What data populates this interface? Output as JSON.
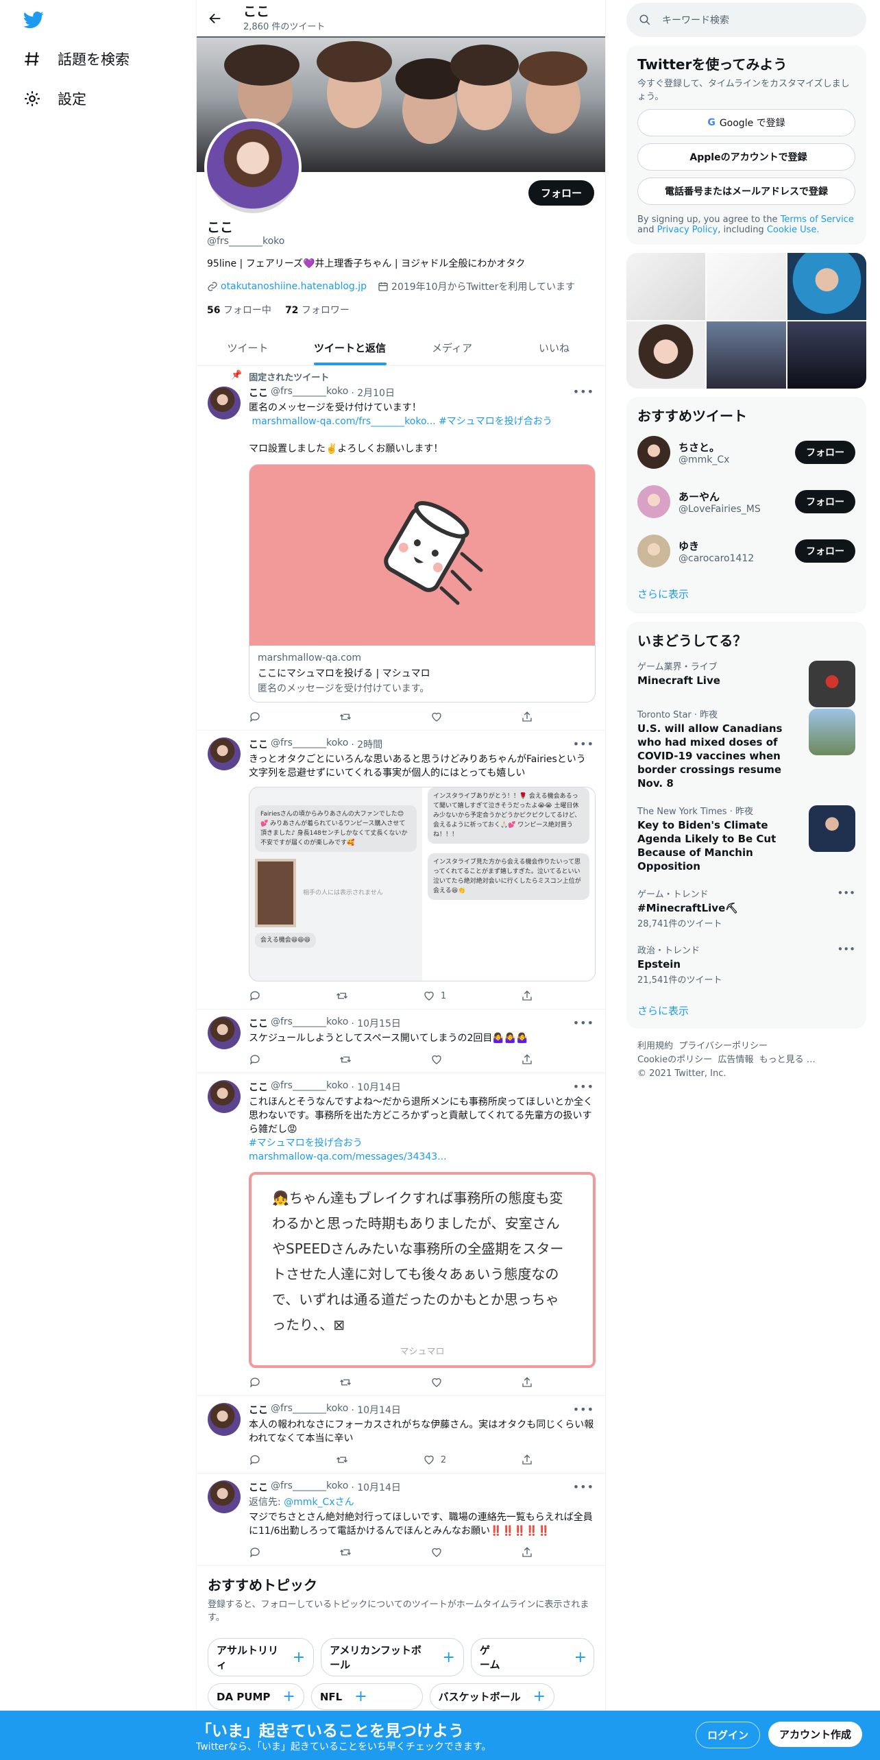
{
  "nav": {
    "explore": "話題を検索",
    "settings": "設定"
  },
  "header": {
    "title": "ここ",
    "tweet_count": "2,860 件のツイート"
  },
  "profile": {
    "follow": "フォロー",
    "name": "ここ",
    "handle": "@frs_______koko",
    "bio": "95line | フェアリーズ💜井上理香子ちゃん | ヨジャドル全般にわかオタク",
    "link": "otakutanoshiine.hatenablog.jp",
    "joined": "2019年10月からTwitterを利用しています",
    "following_count": "56",
    "following_label": "フォロー中",
    "followers_count": "72",
    "followers_label": "フォロワー"
  },
  "tabs": [
    "ツイート",
    "ツイートと返信",
    "メディア",
    "いいね"
  ],
  "tweets": [
    {
      "pinned": "固定されたツイート",
      "name": "ここ",
      "handle": "@frs_______koko",
      "time": "· 2月10日",
      "l1": "匿名のメッセージを受け付けています！",
      "l2a": "marshmallow-qa.com/frs_______koko...",
      "l2b": "#マシュマロを投げ合おう",
      "l3": "マロ設置しました✌️よろしくお願いします！",
      "card_domain": "marshmallow-qa.com",
      "card_title": "ここにマシュマロを投げる | マシュマロ",
      "card_desc": "匿名のメッセージを受け付けています。"
    },
    {
      "name": "ここ",
      "handle": "@frs_______koko",
      "time": "· 2時間",
      "text": "きっとオタクごとにいろんな思いあると思うけどみりあちゃんがFairiesという文字列を忌避せずにいてくれる事実が個人的にはとっても嬉しい",
      "likes": "1",
      "s1": "Fairiesさんの頃からみりあさんの大ファンでした😊💕 みりあさんが着られているワンピース購入させて頂きました♪ 身長148センチしかなくて丈長くないか不安ですが届くのが楽しみです🥰",
      "s2": "インスタライブありがとう！！🌹 会える機会あるって聞いて嬉しすぎて泣きそうだったよ😭😭 土曜日休み少ないから予定合うかどうかピクピクしてるけど、会えるように祈っておく🙏🏻💕 ワンピース絶対買うね！！！",
      "s3": "インスタライブ見た方から会える機会作りたいって思ってくれてることがまず嬉しすぎた。泣いてるといい泣いてたら絶対絶対会いに行くしたらミスコン上位が会える😆👏",
      "s4": "会える機会😆😆😆",
      "s5": "相手の人には表示されません"
    },
    {
      "name": "ここ",
      "handle": "@frs_______koko",
      "time": "· 10月15日",
      "text": "スケジュールしようとしてスペース開いてしまうの2回目🤷‍♀️🤷‍♀️🤷‍♀️"
    },
    {
      "name": "ここ",
      "handle": "@frs_______koko",
      "time": "· 10月14日",
      "text": "これほんとそうなんですよね〜だから退所メンにも事務所戻ってほしいとか全く思わないです。事務所を出た方どころかずっと貢献してくれてる先輩方の扱いすら雑だし😡",
      "tag": "#マシュマロを投げ合おう",
      "link": "marshmallow-qa.com/messages/34343...",
      "quote": "👧ちゃん達もブレイクすれば事務所の態度も変わるかと思った時期もありましたが、安室さんやSPEEDさんみたいな事務所の全盛期をスタートさせた人達に対しても後々あぁいう態度なので、いずれは通る道だったのかもとか思っちゃったり、、⊠",
      "quote_footer": "マシュマロ"
    },
    {
      "name": "ここ",
      "handle": "@frs_______koko",
      "time": "· 10月14日",
      "text": "本人の報われなさにフォーカスされがちな伊藤さん。実はオタクも同じくらい報われてなくて本当に辛い",
      "likes": "2"
    },
    {
      "name": "ここ",
      "handle": "@frs_______koko",
      "time": "· 10月14日",
      "reply_label": "返信先:",
      "reply_to": "@mmk_Cxさん",
      "text": "マジでちさとさん絶対絶対行ってほしいです、職場の連絡先一覧もらえれば全員に11/6出勤しろって電話かけるんでほんとみんなお願い‼️‼️‼️‼️‼️"
    }
  ],
  "topics": {
    "title": "おすすめトピック",
    "desc": "登録すると、フォローしているトピックについてのツイートがホームタイムラインに表示されます。",
    "chips": [
      "アサルトリリィ",
      "アメリカンフットボール",
      "ゲーム",
      "DA PUMP",
      "NFL",
      "バスケットボール"
    ]
  },
  "right": {
    "search_placeholder": "キーワード検索",
    "signup": {
      "title": "Twitterを使ってみよう",
      "sub": "今すぐ登録して、タイムラインをカスタマイズしましょう。",
      "google": "Google で登録",
      "apple": "Appleのアカウントで登録",
      "phone": "電話番号またはメールアドレスで登録",
      "terms_pre": "By signing up, you agree to the",
      "terms_tos": "Terms of Service",
      "terms_and": "and",
      "terms_pp": "Privacy Policy",
      "terms_inc": ", including",
      "terms_cookie": "Cookie Use."
    },
    "rec": {
      "title": "おすすめツイート",
      "users": [
        {
          "name": "ちさと。",
          "handle": "@mmk_Cx",
          "btn": "フォロー"
        },
        {
          "name": "あーやん",
          "handle": "@LoveFairies_MS",
          "btn": "フォロー"
        },
        {
          "name": "ゆき",
          "handle": "@carocaro1412",
          "btn": "フォロー"
        }
      ],
      "more": "さらに表示"
    },
    "trends": {
      "title": "いまどうしてる？",
      "items": [
        {
          "ctx": "ゲーム業界・ライブ",
          "title": "Minecraft Live"
        },
        {
          "ctx": "Toronto Star",
          "time": "· 昨夜",
          "title": "U.S. will allow Canadians who had mixed doses of COVID-19 vaccines when border crossings resume Nov. 8"
        },
        {
          "ctx": "The New York Times",
          "time": "· 昨夜",
          "title": "Key to Biden's Climate Agenda Likely to Be Cut Because of Manchin Opposition"
        },
        {
          "ctx": "ゲーム・トレンド",
          "title": "#MinecraftLive⛏",
          "count": "28,741件のツイート"
        },
        {
          "ctx": "政治・トレンド",
          "title": "Epstein",
          "count": "21,541件のツイート"
        }
      ],
      "more": "さらに表示"
    },
    "footer": {
      "a": "利用規約",
      "b": "プライバシーポリシー",
      "c": "Cookieのポリシー",
      "d": "広告情報",
      "e": "もっと見る …",
      "copy": "© 2021 Twitter, Inc."
    }
  },
  "bottom": {
    "title": "「いま」起きていることを見つけよう",
    "sub": "Twitterなら、「いま」起きていることをいち早くチェックできます。",
    "login": "ログイン",
    "signup": "アカウント作成"
  }
}
